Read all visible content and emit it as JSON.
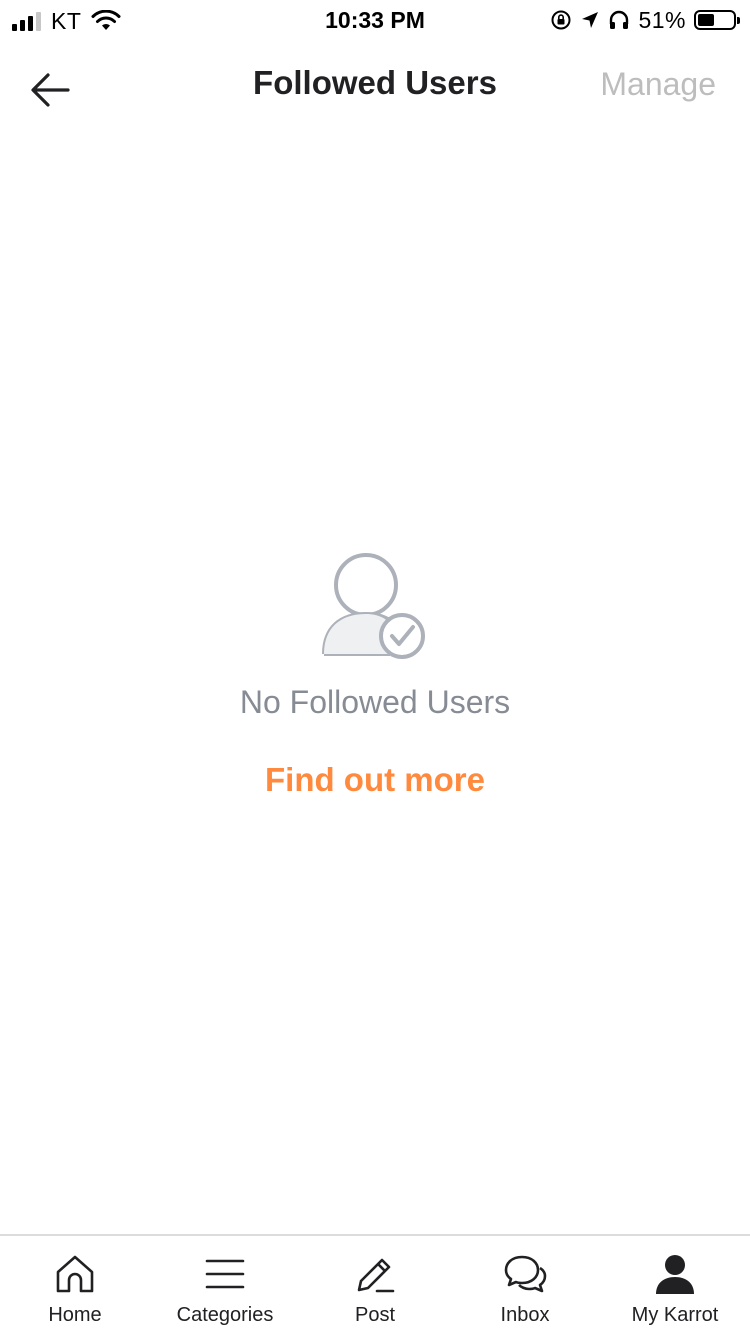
{
  "status_bar": {
    "carrier": "KT",
    "time": "10:33 PM",
    "battery": "51%",
    "battery_level": 0.51
  },
  "header": {
    "back_icon": "arrow-left-icon",
    "title": "Followed Users",
    "manage_label": "Manage",
    "manage_color": "#bdbdbd"
  },
  "empty_state": {
    "icon": "user-check-icon",
    "message": "No Followed Users",
    "link_label": "Find out more",
    "link_color": "#ff8a3d"
  },
  "tab_bar": {
    "tabs": [
      {
        "label": "Home",
        "icon": "home-icon"
      },
      {
        "label": "Categories",
        "icon": "menu-icon"
      },
      {
        "label": "Post",
        "icon": "pencil-icon"
      },
      {
        "label": "Inbox",
        "icon": "chat-bubbles-icon"
      },
      {
        "label": "My Karrot",
        "icon": "profile-icon",
        "active": true
      }
    ]
  }
}
